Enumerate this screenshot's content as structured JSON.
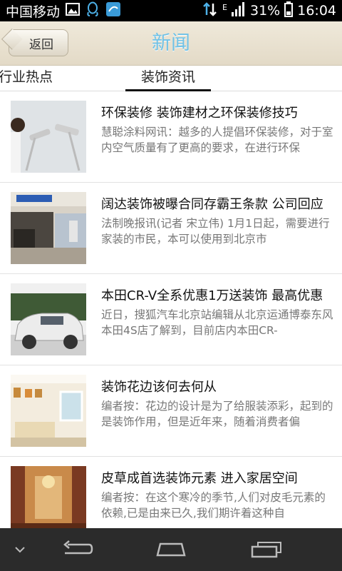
{
  "status_bar": {
    "carrier": "中国移动",
    "network_type": "E",
    "battery": "31%",
    "time": "16:04"
  },
  "header": {
    "back_label": "返回",
    "title": "新闻"
  },
  "tabs": [
    {
      "label": "行业热点",
      "active": false
    },
    {
      "label": "装饰资讯",
      "active": true
    }
  ],
  "articles": [
    {
      "title": "环保装修 装饰建材之环保装修技巧",
      "summary": "慧聪涂料网讯：越多的人提倡环保装修，对于室内空气质量有了更高的要求，在进行环保"
    },
    {
      "title": "阔达装饰被曝合同存霸王条款 公司回应",
      "summary": "法制晚报讯(记者 宋立伟) 1月1日起，需要进行家装的市民，本可以使用到北京市"
    },
    {
      "title": "本田CR-V全系优惠1万送装饰 最高优惠",
      "summary": "近日，搜狐汽车北京站编辑从北京运通博泰东风本田4S店了解到，目前店内本田CR-"
    },
    {
      "title": "装饰花边该何去何从",
      "summary": "编者按：花边的设计是为了给服装添彩，起到的是装饰作用，但是近年来，随着消费者偏"
    },
    {
      "title": "皮草成首选装饰元素 进入家居空间",
      "summary": "编者按：在这个寒冷的季节,人们对皮毛元素的依赖,已是由来已久,我们期许着这种自"
    }
  ],
  "colors": {
    "title_accent": "#6fc1e6",
    "status_bar": "#000000",
    "nav_bar": "#2b2b2b"
  }
}
